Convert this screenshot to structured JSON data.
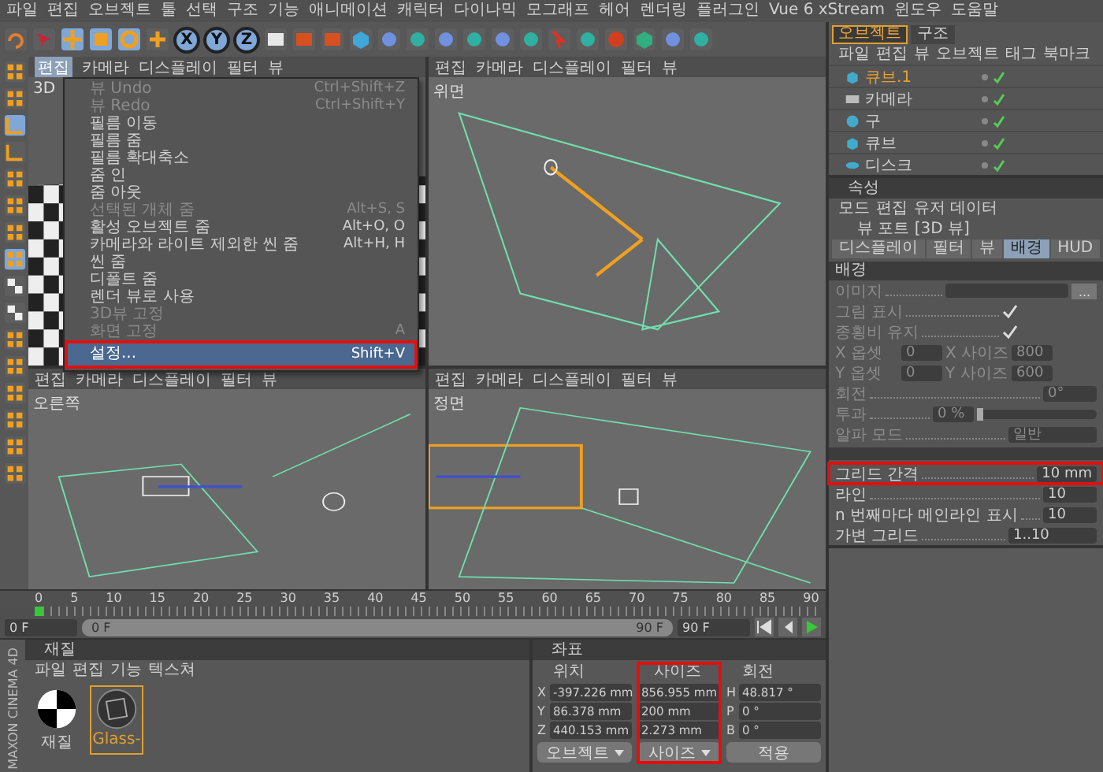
{
  "menubar": [
    "파일",
    "편집",
    "오브젝트",
    "툴",
    "선택",
    "구조",
    "기능",
    "애니메이션",
    "캐릭터",
    "다이나믹",
    "모그래프",
    "헤어",
    "렌더링",
    "플러그인",
    "Vue 6 xStream",
    "윈도우",
    "도움말"
  ],
  "toolbar": {
    "axis_buttons": [
      "X",
      "Y",
      "Z"
    ]
  },
  "viewports": [
    {
      "label": "3D",
      "kind": "perspective",
      "menu": [
        {
          "label": "편집",
          "selected": true
        },
        {
          "label": "카메라",
          "selected": false
        },
        {
          "label": "디스플레이",
          "selected": false
        },
        {
          "label": "필터",
          "selected": false
        },
        {
          "label": "뷰",
          "selected": false
        }
      ]
    },
    {
      "label": "위면",
      "kind": "top",
      "menu": [
        {
          "label": "편집",
          "selected": false
        },
        {
          "label": "카메라",
          "selected": false
        },
        {
          "label": "디스플레이",
          "selected": false
        },
        {
          "label": "필터",
          "selected": false
        },
        {
          "label": "뷰",
          "selected": false
        }
      ]
    },
    {
      "label": "오른쪽",
      "kind": "right",
      "menu": [
        {
          "label": "편집",
          "selected": false
        },
        {
          "label": "카메라",
          "selected": false
        },
        {
          "label": "디스플레이",
          "selected": false
        },
        {
          "label": "필터",
          "selected": false
        },
        {
          "label": "뷰",
          "selected": false
        }
      ]
    },
    {
      "label": "정면",
      "kind": "front",
      "menu": [
        {
          "label": "편집",
          "selected": false
        },
        {
          "label": "카메라",
          "selected": false
        },
        {
          "label": "디스플레이",
          "selected": false
        },
        {
          "label": "필터",
          "selected": false
        },
        {
          "label": "뷰",
          "selected": false
        }
      ]
    }
  ],
  "edit_menu": {
    "items": [
      {
        "label": "뷰 Undo",
        "shortcut": "Ctrl+Shift+Z",
        "disabled": true,
        "selected": false,
        "highlighted": false
      },
      {
        "label": "뷰 Redo",
        "shortcut": "Ctrl+Shift+Y",
        "disabled": true,
        "selected": false,
        "highlighted": false
      },
      {
        "label": "필름 이동",
        "disabled": false,
        "selected": false,
        "highlighted": false
      },
      {
        "label": "필름 줌",
        "disabled": false,
        "selected": false,
        "highlighted": false
      },
      {
        "label": "필름 확대축소",
        "disabled": false,
        "selected": false,
        "highlighted": false
      },
      {
        "label": "줌 인",
        "disabled": false,
        "selected": false,
        "highlighted": false
      },
      {
        "label": "줌 아웃",
        "disabled": false,
        "selected": false,
        "highlighted": false
      },
      {
        "label": "선택된 개체 줌",
        "shortcut": "Alt+S, S",
        "disabled": true,
        "selected": false,
        "highlighted": false
      },
      {
        "label": "활성 오브젝트 줌",
        "shortcut": "Alt+O, O",
        "disabled": false,
        "selected": false,
        "highlighted": false
      },
      {
        "label": "카메라와 라이트 제외한 씬 줌",
        "shortcut": "Alt+H, H",
        "disabled": false,
        "selected": false,
        "highlighted": false
      },
      {
        "label": "씬 줌",
        "disabled": false,
        "selected": false,
        "highlighted": false
      },
      {
        "label": "디폴트 줌",
        "disabled": false,
        "selected": false,
        "highlighted": false
      },
      {
        "label": "렌더 뷰로 사용",
        "disabled": false,
        "selected": false,
        "highlighted": false
      },
      {
        "label": "3D뷰 고정",
        "disabled": true,
        "selected": false,
        "highlighted": false
      },
      {
        "label": "화면 고정",
        "shortcut": "A",
        "disabled": true,
        "selected": false,
        "highlighted": false
      },
      {
        "label": "설정...",
        "shortcut": "Shift+V",
        "disabled": false,
        "selected": true,
        "highlighted": true
      }
    ]
  },
  "object_manager": {
    "tabs": [
      {
        "label": "오브젝트",
        "selected": true
      },
      {
        "label": "구조",
        "selected": false
      }
    ],
    "menu": [
      "파일",
      "편집",
      "뷰",
      "오브젝트",
      "태그",
      "북마크"
    ],
    "objects": [
      {
        "name": "큐브.1",
        "kind": "cube",
        "selected": true
      },
      {
        "name": "카메라",
        "kind": "camera",
        "selected": false
      },
      {
        "name": "구",
        "kind": "sphere",
        "selected": false
      },
      {
        "name": "큐브",
        "kind": "cube",
        "selected": false
      },
      {
        "name": "디스크",
        "kind": "disc",
        "selected": false
      }
    ]
  },
  "attributes": {
    "title": "속성",
    "menu": [
      "모드",
      "편집",
      "유저 데이터"
    ],
    "object": "뷰 포트 [3D 뷰]",
    "tabs": [
      {
        "label": "디스플레이",
        "selected": false
      },
      {
        "label": "필터",
        "selected": false
      },
      {
        "label": "뷰",
        "selected": false
      },
      {
        "label": "배경",
        "selected": true
      },
      {
        "label": "HUD",
        "selected": false
      }
    ],
    "section": "배경",
    "rows": [
      {
        "kind": "file",
        "label": "이미지",
        "button": "...",
        "disabled": true,
        "highlighted": false
      },
      {
        "kind": "check",
        "label": "그림 표시",
        "checked": true,
        "disabled": true,
        "highlighted": false
      },
      {
        "kind": "check",
        "label": "종횡비 유지",
        "checked": true,
        "disabled": true,
        "highlighted": false
      },
      {
        "kind": "pair",
        "items": [
          {
            "label": "X 옵셋",
            "value": "0"
          },
          {
            "label": "X 사이즈",
            "value": "800"
          }
        ],
        "disabled": true,
        "highlighted": false
      },
      {
        "kind": "pair",
        "items": [
          {
            "label": "Y 옵셋",
            "value": "0"
          },
          {
            "label": "Y 사이즈",
            "value": "600"
          }
        ],
        "disabled": true,
        "highlighted": false
      },
      {
        "kind": "number",
        "label": "회전",
        "value": "0°",
        "disabled": true,
        "highlighted": false
      },
      {
        "kind": "slider",
        "label": "투과",
        "value": "0 %",
        "level": 0,
        "disabled": true,
        "highlighted": false
      },
      {
        "kind": "dropdown",
        "label": "알파 모드",
        "value": "일반",
        "disabled": true,
        "highlighted": false
      },
      {
        "kind": "divider"
      },
      {
        "kind": "number",
        "label": "그리드 간격",
        "value": "10 mm",
        "disabled": false,
        "highlighted": true
      },
      {
        "kind": "number",
        "label": "라인",
        "value": "10",
        "disabled": false,
        "highlighted": false
      },
      {
        "kind": "number",
        "label": "n 번째마다 메인라인 표시",
        "value": "10",
        "disabled": false,
        "highlighted": false
      },
      {
        "kind": "dropdown",
        "label": "가변 그리드",
        "value": "1..10",
        "disabled": false,
        "highlighted": false
      }
    ]
  },
  "timeline": {
    "ticks": [
      "0",
      "5",
      "10",
      "15",
      "20",
      "25",
      "30",
      "35",
      "40",
      "45",
      "50",
      "55",
      "60",
      "65",
      "70",
      "75",
      "80",
      "85",
      "90"
    ],
    "current": "0 F",
    "range": {
      "start": "0 F",
      "end": "90 F",
      "level": 1
    },
    "end": "90 F",
    "level": 0
  },
  "material_manager": {
    "title": "재질",
    "menu": [
      "파일",
      "편집",
      "기능",
      "텍스쳐"
    ],
    "materials": [
      {
        "name": "재질",
        "kind": "checker",
        "selected": false
      },
      {
        "name": "Glass-",
        "kind": "glass",
        "selected": true
      }
    ]
  },
  "coordinates": {
    "title": "좌표",
    "columns": [
      {
        "heading": "위치",
        "highlighted": false,
        "rows": [
          {
            "axis": "X",
            "value": "-397.226 mm"
          },
          {
            "axis": "Y",
            "value": "86.378 mm"
          },
          {
            "axis": "Z",
            "value": "440.153 mm"
          }
        ],
        "footer": {
          "kind": "dropdown",
          "label": "오브젝트"
        }
      },
      {
        "heading": "사이즈",
        "highlighted": true,
        "rows": [
          {
            "value": "856.955 mm"
          },
          {
            "value": "200 mm"
          },
          {
            "value": "2.273 mm"
          }
        ],
        "footer": {
          "kind": "dropdown",
          "label": "사이즈"
        }
      },
      {
        "heading": "회전",
        "highlighted": false,
        "rows": [
          {
            "axis": "H",
            "value": "48.817 °"
          },
          {
            "axis": "P",
            "value": "0 °"
          },
          {
            "axis": "B",
            "value": "0 °"
          }
        ],
        "footer": {
          "kind": "button",
          "label": "적용"
        }
      }
    ]
  },
  "logo": "MAXON CINEMA 4D"
}
